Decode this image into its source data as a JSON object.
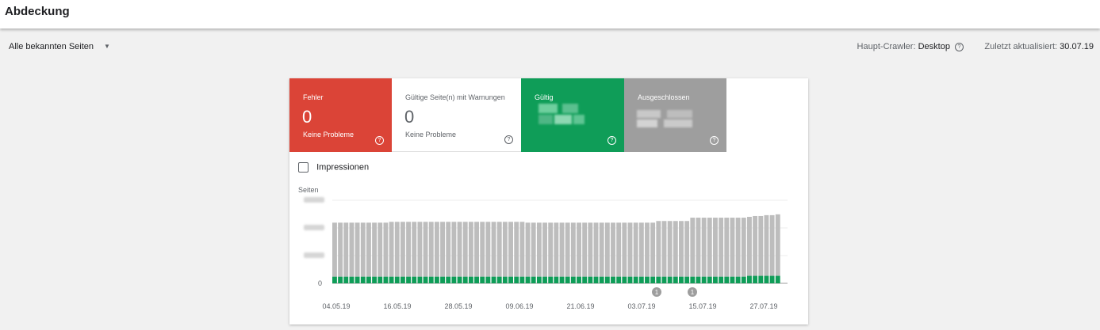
{
  "header": {
    "title": "Abdeckung"
  },
  "filter": {
    "dropdown_label": "Alle bekannten Seiten",
    "crawler_label": "Haupt-Crawler:",
    "crawler_value": "Desktop",
    "updated_label": "Zuletzt aktualisiert:",
    "updated_value": "30.07.19"
  },
  "tiles": [
    {
      "label": "Fehler",
      "value": "0",
      "sub": "Keine Probleme",
      "color": "#db4437"
    },
    {
      "label": "Gültige Seite(n) mit Warnungen",
      "value": "0",
      "sub": "Keine Probleme",
      "color": "#ffffff"
    },
    {
      "label": "Gültig",
      "value": "",
      "sub": "",
      "color": "#0f9d58"
    },
    {
      "label": "Ausgeschlossen",
      "value": "",
      "sub": "",
      "color": "#9e9e9e"
    }
  ],
  "impressions_label": "Impressionen",
  "chart_data": {
    "type": "bar",
    "stacked": true,
    "ylabel": "Seiten",
    "ytick_labels": [
      "0"
    ],
    "xtick_labels": [
      "04.05.19",
      "16.05.19",
      "28.05.19",
      "09.06.19",
      "21.06.19",
      "03.07.19",
      "15.07.19",
      "27.07.19"
    ],
    "series": [
      {
        "color": "#0f9d58",
        "values": [
          8,
          8,
          8,
          8,
          8,
          8,
          8,
          8,
          8,
          8,
          8,
          8,
          8,
          8,
          8,
          8,
          8,
          8,
          8,
          8,
          8,
          8,
          8,
          8,
          8,
          8,
          8,
          8,
          8,
          8,
          8,
          8,
          8,
          8,
          8,
          8,
          8,
          8,
          8,
          8,
          8,
          8,
          8,
          8,
          8,
          8,
          8,
          8,
          8,
          8,
          8,
          8,
          8,
          8,
          8,
          8,
          8,
          8,
          8,
          8,
          8,
          8,
          8,
          8,
          8,
          8,
          8,
          8,
          8,
          8,
          8,
          8,
          8,
          9,
          9,
          9,
          9,
          9,
          9
        ]
      },
      {
        "color": "#bdbdbd",
        "values": [
          65,
          65,
          65,
          65,
          65,
          65,
          65,
          65,
          65,
          65,
          66,
          66,
          66,
          66,
          66,
          66,
          66,
          66,
          66,
          66,
          66,
          66,
          66,
          66,
          66,
          66,
          66,
          66,
          66,
          66,
          66,
          66,
          66,
          66,
          65,
          65,
          65,
          65,
          65,
          65,
          65,
          65,
          65,
          65,
          65,
          65,
          65,
          65,
          65,
          65,
          65,
          65,
          65,
          65,
          65,
          65,
          65,
          67,
          67,
          67,
          67,
          67,
          67,
          71,
          71,
          71,
          71,
          71,
          71,
          71,
          71,
          71,
          71,
          71,
          72,
          72,
          73,
          73,
          74
        ]
      }
    ],
    "annotations": [
      {
        "label": "1",
        "x": "05.07.19"
      },
      {
        "label": "1",
        "x": "11.07.19"
      }
    ],
    "grid": true
  }
}
